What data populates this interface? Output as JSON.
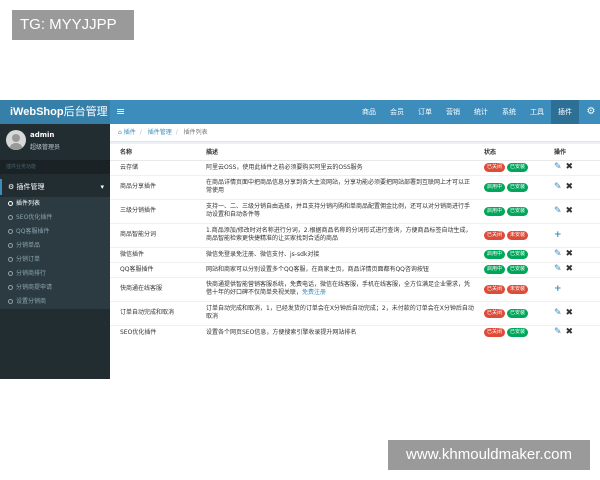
{
  "watermarks": {
    "top": "TG: MYYJJPP",
    "bottom": "www.khmouldmaker.com"
  },
  "navbar": {
    "brand_bold": "iWebShop",
    "brand_rest": "后台管理",
    "menu_icon": "≡",
    "items": [
      "商品",
      "会员",
      "订单",
      "营销",
      "统计",
      "系统",
      "工具",
      "插件"
    ],
    "active_item": "插件",
    "gear_icon": "gear-icon"
  },
  "sidebar": {
    "user_name": "admin",
    "user_role": "超级管理员",
    "section_header": "插件业务功能",
    "menu_head": "插件管理",
    "items": [
      "插件列表",
      "SEO优化插件",
      "QQ客服插件",
      "分销单品",
      "分销订单",
      "分销商排行",
      "分销商提申请",
      "设置分销商"
    ]
  },
  "breadcrumb": {
    "items": [
      "插件",
      "插件管理",
      "插件列表"
    ]
  },
  "table": {
    "headers": [
      "名称",
      "描述",
      "状态",
      "操作"
    ],
    "rows": [
      {
        "name": "云存储",
        "desc": "阿里云OSS，使用此插件之前必须要购买阿里云的OSS服务",
        "status": [
          "已关闭",
          "已安装"
        ]
      },
      {
        "name": "商品分享插件",
        "desc": "在商品详情页面中把商品信息分享到各大主流网站，分享功能必须要把网站部署到互联网上才可以正常使用",
        "status": [
          "启用中",
          "已安装"
        ]
      },
      {
        "name": "三级分销插件",
        "desc": "支持一、二、三级分销自由选择，并且支持分销内购和单商品配置佣金比例，还可以对分销商进行手动设置和自动条件等",
        "status": [
          "启用中",
          "已安装"
        ]
      },
      {
        "name": "商品智能分词",
        "desc": "1.商品添加/修改时对名称进行分词，2.根据商品名称的分词形式进行查询，方便商品标签自动生成，商品智能检索更快捷精准的让买家找到合适的商品",
        "status": [
          "已关闭",
          "未安装"
        ]
      },
      {
        "name": "微信插件",
        "desc": "微信免登录免注册、微信支付、js-sdk对接",
        "status": [
          "启用中",
          "已安装"
        ]
      },
      {
        "name": "QQ客服插件",
        "desc": "网站和商家可以分别设置多个QQ客服，在商家主页，商品详情页面都有QQ咨询按钮",
        "status": [
          "启用中",
          "已安装"
        ]
      },
      {
        "name": "快商通在线客服",
        "desc": "快商通提供智能营销客服系统，免费电话，微信在线客服，手机在线客服，全方位满足企业需求，凭借十年的好口碑不仅简单央视关联，",
        "desc_link": "免费注册",
        "status": [
          "已关闭",
          "未安装"
        ]
      },
      {
        "name": "订单自动完成和取消",
        "desc": "订单自动完成和取消，1，已经发货的订单会在X分钟后自动完成；2，未付款的订单会在X分钟后自动取消",
        "status": [
          "已关闭",
          "已安装"
        ]
      },
      {
        "name": "SEO优化插件",
        "desc": "设置各个网页SEO信息，方便搜索引擎收录提升网站排名",
        "status": [
          "已关闭",
          "已安装"
        ]
      }
    ],
    "actions": {
      "installed": [
        "✎",
        "✖"
      ],
      "uninstalled": [
        "+"
      ]
    }
  },
  "colors": {
    "accent": "#3c8dbc",
    "sidebar": "#222d32",
    "red": "#dd4b39",
    "green": "#00a65a"
  }
}
